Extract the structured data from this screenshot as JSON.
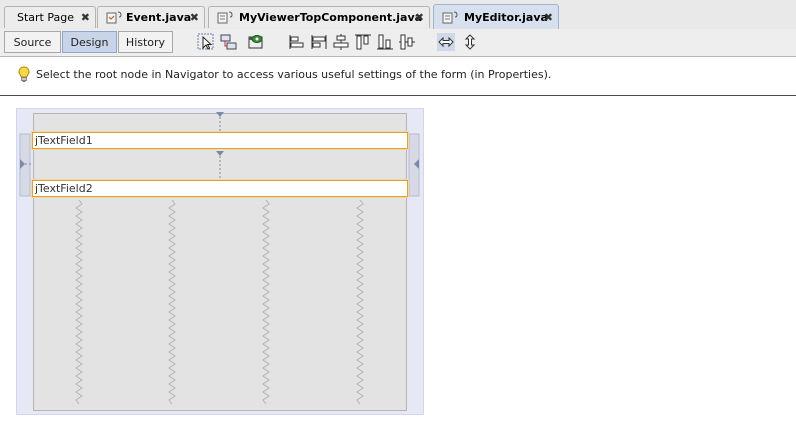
{
  "tabs": [
    {
      "label": "Start Page",
      "close": "✖",
      "icon": "none"
    },
    {
      "label": "Event.java",
      "close": "✖",
      "icon": "java-file-icon"
    },
    {
      "label": "MyViewerTopComponent.java",
      "close": "✖",
      "icon": "java-form-file-icon"
    },
    {
      "label": "MyEditor.java",
      "close": "✖",
      "icon": "java-form-file-icon"
    }
  ],
  "toolbar": {
    "source_label": "Source",
    "design_label": "Design",
    "history_label": "History",
    "active_mode": "Design",
    "icons": [
      "selection-mode-icon",
      "connection-mode-icon",
      "preview-design-icon",
      "align-left-icon",
      "align-right-icon",
      "center-horizontally-icon",
      "align-top-icon",
      "align-bottom-icon",
      "center-vertically-icon",
      "change-horizontal-resizability-icon",
      "change-vertical-resizability-icon"
    ]
  },
  "hint": {
    "icon": "lightbulb-icon",
    "text": "Select the root node in Navigator to access various useful settings of the form (in Properties)."
  },
  "form": {
    "fields": [
      {
        "name": "jTextField1",
        "value": "jTextField1"
      },
      {
        "name": "jTextField2",
        "value": "jTextField2"
      }
    ]
  },
  "colors": {
    "active_tab": "#d7e0ee",
    "active_mode": "#c8d5e8",
    "selection_border": "#e0a036",
    "surface": "#e6e8f6",
    "form_bg": "#e3e3e3"
  }
}
